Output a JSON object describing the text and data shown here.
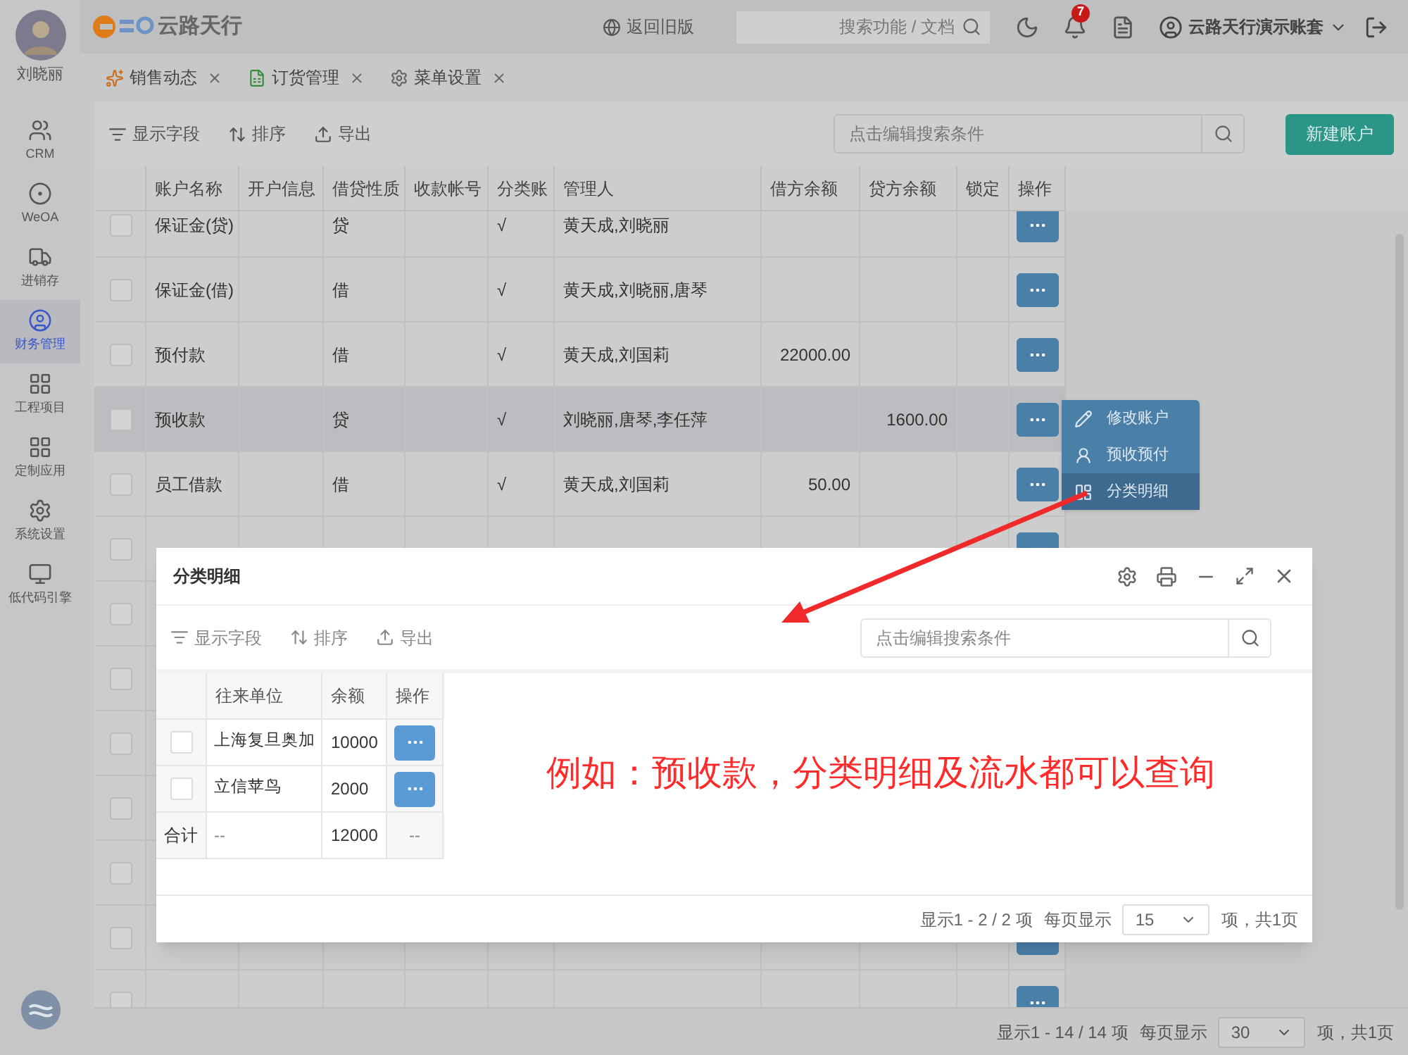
{
  "user": {
    "name": "刘晓丽"
  },
  "sidebar": {
    "items": [
      {
        "label": "CRM",
        "selected": false
      },
      {
        "label": "WeOA",
        "selected": false
      },
      {
        "label": "进销存",
        "selected": false
      },
      {
        "label": "财务管理",
        "selected": true
      },
      {
        "label": "工程项目",
        "selected": false
      },
      {
        "label": "定制应用",
        "selected": false
      },
      {
        "label": "系统设置",
        "selected": false
      },
      {
        "label": "低代码引擎",
        "selected": false
      }
    ]
  },
  "header": {
    "brand": "云路天行",
    "back_link": "返回旧版",
    "search": {
      "placeholder": "搜索功能 / 文档"
    },
    "notification_badge": "7",
    "account": "云路天行演示账套"
  },
  "tabs": [
    {
      "label": "销售动态"
    },
    {
      "label": "订货管理"
    },
    {
      "label": "菜单设置"
    }
  ],
  "toolbar": {
    "actions": [
      "显示字段",
      "排序",
      "导出"
    ],
    "search": {
      "placeholder": "点击编辑搜索条件"
    },
    "new_button": "新建账户"
  },
  "table": {
    "columns": [
      "账户名称",
      "开户信息",
      "借贷性质",
      "收款帐号",
      "分类账",
      "管理人",
      "借方余额",
      "贷方余额",
      "锁定",
      "操作"
    ],
    "rows": [
      {
        "checked": false,
        "selected": false,
        "name": "保证金(贷)",
        "nature": "贷",
        "ledger": "√",
        "managers": "黄天成,刘晓丽"
      },
      {
        "checked": false,
        "selected": false,
        "name": "保证金(借)",
        "nature": "借",
        "ledger": "√",
        "managers": "黄天成,刘晓丽,唐琴"
      },
      {
        "checked": false,
        "selected": false,
        "name": "预付款",
        "nature": "借",
        "ledger": "√",
        "managers": "黄天成,刘国莉",
        "debit": "22000.00"
      },
      {
        "checked": false,
        "selected": true,
        "name": "预收款",
        "nature": "贷",
        "ledger": "√",
        "managers": "刘晓丽,唐琴,李任萍",
        "credit": "1600.00"
      },
      {
        "checked": false,
        "selected": false,
        "name": "员工借款",
        "nature": "借",
        "ledger": "√",
        "managers": "黄天成,刘国莉",
        "debit": "50.00"
      },
      {
        "checked": false,
        "selected": false
      },
      {
        "checked": false,
        "selected": false
      },
      {
        "checked": false,
        "selected": false
      },
      {
        "checked": false,
        "selected": false
      },
      {
        "checked": false,
        "selected": false
      },
      {
        "checked": false,
        "selected": false
      },
      {
        "checked": false,
        "selected": false
      },
      {
        "checked": false,
        "selected": false
      }
    ]
  },
  "row_menu": {
    "items": [
      {
        "label": "修改账户",
        "selected": false
      },
      {
        "label": "预收预付",
        "selected": false
      },
      {
        "label": "分类明细",
        "selected": true
      }
    ]
  },
  "pagination": {
    "summary": "显示1 - 14 / 14 项",
    "per_page_label": "每页显示",
    "per_page": "30",
    "pages": "项，共1页"
  },
  "dialog": {
    "title": "分类明细",
    "actions": [
      "显示字段",
      "排序",
      "导出"
    ],
    "search": {
      "placeholder": "点击编辑搜索条件"
    },
    "table": {
      "columns": [
        "往来单位",
        "余额",
        "操作"
      ],
      "rows": [
        {
          "checked": false,
          "unit": "上海复旦奥加",
          "balance": "10000"
        },
        {
          "checked": false,
          "unit": "立信苹鸟",
          "balance": "2000"
        }
      ],
      "total": {
        "label": "合计",
        "unit": "--",
        "balance": "12000",
        "action": "--"
      }
    },
    "pagination": {
      "summary": "显示1 - 2 / 2 项",
      "per_page_label": "每页显示",
      "per_page": "15",
      "pages": "项，共1页"
    }
  },
  "annotation": {
    "text": "例如：预收款，分类明细及流水都可以查询"
  }
}
